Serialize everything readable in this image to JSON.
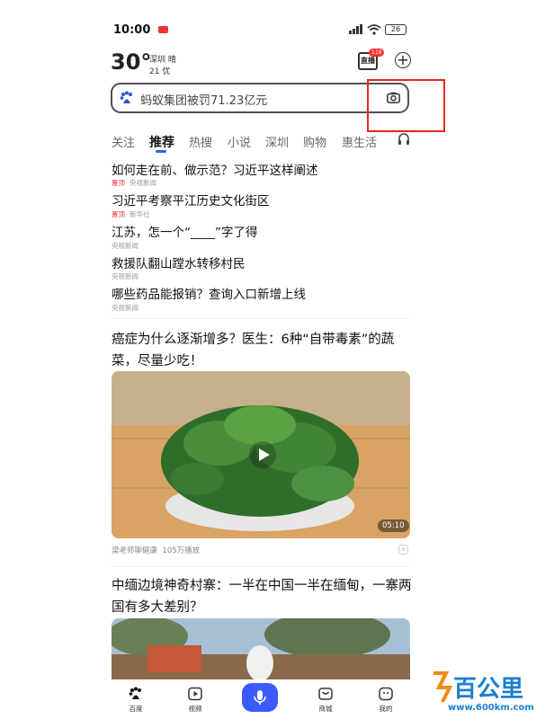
{
  "status_bar": {
    "time": "10:00",
    "battery": "26"
  },
  "weather": {
    "temperature": "30°",
    "city_weather": "深圳 晴",
    "aqi": "21 优"
  },
  "live": {
    "label": "直播",
    "badge": "119"
  },
  "search": {
    "query": "蚂蚁集团被罚71.23亿元"
  },
  "tabs": [
    {
      "label": "关注"
    },
    {
      "label": "推荐"
    },
    {
      "label": "热搜"
    },
    {
      "label": "小说"
    },
    {
      "label": "深圳"
    },
    {
      "label": "购物"
    },
    {
      "label": "惠生活"
    }
  ],
  "news": [
    {
      "title": "如何走在前、做示范？习近平这样阐述",
      "pin": "置顶",
      "source": "央视新闻"
    },
    {
      "title": "习近平考察平江历史文化街区",
      "pin": "置顶",
      "source": "新华社"
    },
    {
      "title": "江苏，怎一个“____”字了得",
      "pin": "",
      "source": "央视新闻"
    },
    {
      "title": "救援队翻山蹚水转移村民",
      "pin": "",
      "source": "央视新闻"
    },
    {
      "title": "哪些药品能报销？查询入口新增上线",
      "pin": "",
      "source": "央视新闻"
    }
  ],
  "video_article": {
    "title": "癌症为什么逐渐增多？医生：6种“自带毒素”的蔬菜，尽量少吃！",
    "duration": "05:10",
    "author": "梁老师聊健康",
    "plays": "105万播放"
  },
  "article2": {
    "title": "中缅边境神奇村寨：一半在中国一半在缅甸，一寨两国有多大差别？"
  },
  "bottom_nav": [
    {
      "label": "百度",
      "icon": "paw-icon"
    },
    {
      "label": "视频",
      "icon": "video-icon"
    },
    {
      "label": "",
      "icon": "mic-icon"
    },
    {
      "label": "商城",
      "icon": "shop-icon"
    },
    {
      "label": "我的",
      "icon": "profile-icon"
    }
  ],
  "watermark": {
    "text": "百公里",
    "url": "www.600km.com"
  },
  "colors": {
    "accent": "#3b5bff",
    "highlight_frame": "#e8261d",
    "pin": "#e33333"
  }
}
